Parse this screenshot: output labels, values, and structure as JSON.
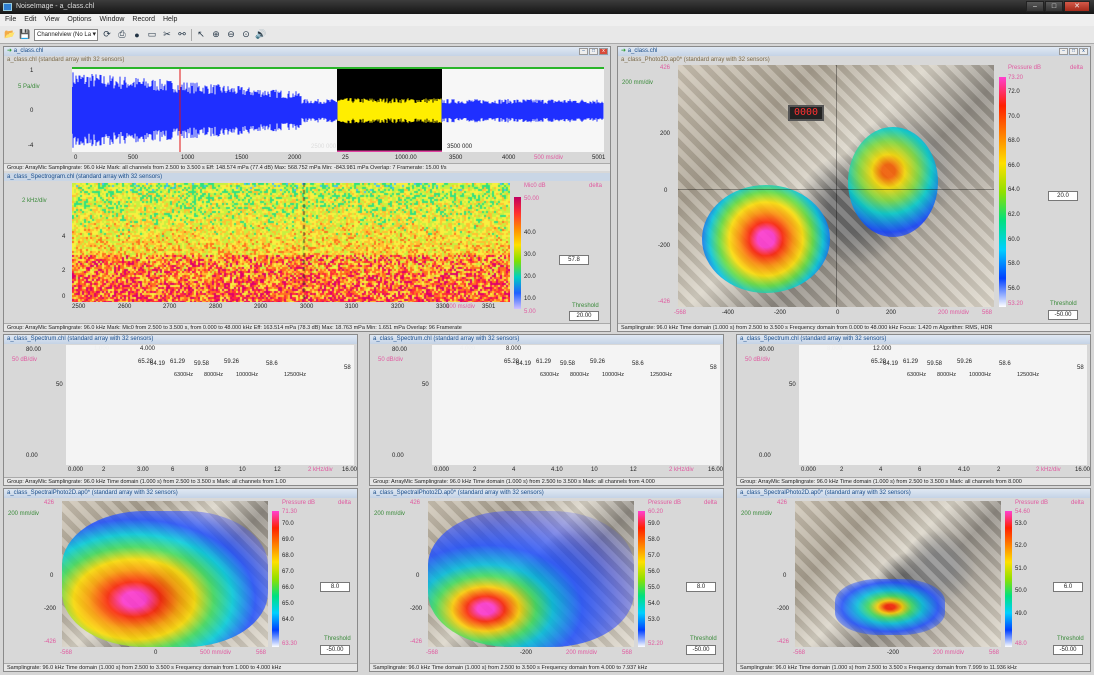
{
  "app": {
    "title": "NoiseImage - a_class.chl",
    "window_buttons": [
      "–",
      "□",
      "✕"
    ]
  },
  "menu": [
    "File",
    "Edit",
    "View",
    "Options",
    "Window",
    "Record",
    "Help"
  ],
  "toolbar": {
    "view_select": "Channelview (No La"
  },
  "top_left": {
    "window_title": "a_class.chl",
    "waveform": {
      "title": "a_class.chl (standard array with 32 sensors)",
      "y_top": "1",
      "y_unit": "5 Pa/div",
      "y_mid": "0",
      "y_bottom": "-4",
      "x_ticks": [
        "0",
        "500",
        "1000",
        "1500",
        "2000",
        "25",
        "1000.00",
        "3500",
        "4000"
      ],
      "x_scale": "500 ms/div",
      "x_end": "5001",
      "marker_left": "2500 000",
      "marker_right": "3500 000",
      "status": "Group: ArrayMic Samplingrate: 96.0 kHz  Mark: all channels from 2.500 to 3.500 s  Eff: 148.574 mPa (77.4 dB)  Max: 568.752 mPa  Min: -843.981 mPa  Overlap: 7   Framerate: 15.00 f/s"
    },
    "spectrogram": {
      "title": "a_class_Spectrogram.chl (standard array with 32 sensors)",
      "y_unit": "2 kHz/div",
      "y_ticks": [
        "4",
        "2",
        "0"
      ],
      "x_ticks": [
        "2500",
        "2600",
        "2700",
        "2800",
        "2900",
        "3000",
        "3100",
        "3200",
        "3300"
      ],
      "x_scale": "100 ms/div",
      "x_end": "3501",
      "cbar_title": "Mic0 dB",
      "cbar_delta": "delta",
      "cbar_ticks": [
        "50.00",
        "40.0",
        "30.0",
        "20.0",
        "10.0"
      ],
      "cbar_bottom": "5.00",
      "value_box": "57.8",
      "threshold_label": "Threshold",
      "threshold_value": "20.00",
      "status": "Group: ArrayMic Samplingrate: 96.0 kHz  Mark: Mic0 from 2.500 to 3.500 s, from 0.000 to 48.000 kHz   Eff: 163.514 mPa (78.3 dB)  Max: 18.763 mPa  Min: 1.651 mPa   Overlap: 96  Framerate"
    }
  },
  "top_right": {
    "window_title": "a_class.chl",
    "title": "a_class_Photo2D.ap0* (standard array with 32 sensors)",
    "y_top": "426",
    "y_unit": "200 mm/div",
    "y_ticks": [
      "200",
      "0",
      "-200"
    ],
    "y_bottom": "-426",
    "x_ticks": [
      "-568",
      "-400",
      "-200",
      "0",
      "200"
    ],
    "x_scale": "200 mm/div",
    "x_end": "568",
    "display_reading": "0000",
    "cbar_title": "Pressure dB",
    "cbar_delta": "delta",
    "cbar_top": "73.20",
    "cbar_ticks": [
      "72.0",
      "70.0",
      "68.0",
      "66.0",
      "64.0",
      "62.0",
      "60.0",
      "58.0",
      "56.0"
    ],
    "cbar_bottom": "53.20",
    "value_box": "20.0",
    "threshold_label": "Threshold",
    "threshold_value": "-50.00",
    "status": "Samplingrate: 96.0 kHz  Time domain (1.000 s) from 2.500 to 3.500 s  Frequency domain from 0.000 to 48.000 kHz  Focus: 1.420 m  Algorithm: RMS, HDR"
  },
  "spectra": [
    {
      "title": "a_class_Spectrum.chl (standard array with 32 sensors)",
      "y_top": "80.00",
      "y_unit": "50 dB/div",
      "y_mid": "50",
      "y_bottom": "0.00",
      "band_label_left": "1.000",
      "band_label_right": "4.000",
      "peaks": [
        "65.20",
        "64.19",
        "61.29",
        "59.58",
        "59.26",
        "58.6"
      ],
      "bands": [
        "6300Hz",
        "8000Hz",
        "10000Hz",
        "12500Hz"
      ],
      "x_ticks": [
        "0.000",
        "2",
        "3.00",
        "6",
        "8",
        "10",
        "12",
        "2 kHz/div",
        "16.000"
      ],
      "right_edge": "58",
      "status": "Group: ArrayMic Samplingrate: 96.0 kHz  Time domain (1.000 s) from 2.500 to 3.500 s  Mark: all channels from 1.00"
    },
    {
      "title": "a_class_Spectrum.chl (standard array with 32 sensors)",
      "y_top": "80.00",
      "y_unit": "50 dB/div",
      "y_mid": "50",
      "y_bottom": "0.00",
      "band_label_left": "4.000",
      "band_label_right": "8.000",
      "peaks": [
        "65.20",
        "64.19",
        "61.29",
        "59.58",
        "59.26",
        "58.6"
      ],
      "bands": [
        "6300Hz",
        "8000Hz",
        "10000Hz",
        "12500Hz"
      ],
      "x_ticks": [
        "0.000",
        "2",
        "4",
        "4.10",
        "10",
        "12",
        "2 kHz/div",
        "16.000"
      ],
      "right_edge": "58",
      "status": "Group: ArrayMic Samplingrate: 96.0 kHz  Time domain (1.000 s) from 2.500 to 3.500 s  Mark: all channels from 4.000"
    },
    {
      "title": "a_class_Spectrum.chl (standard array with 32 sensors)",
      "y_top": "80.00",
      "y_unit": "50 dB/div",
      "y_mid": "50",
      "y_bottom": "0.00",
      "band_label_left": "8.000",
      "band_label_right": "12.000",
      "peaks": [
        "65.20",
        "64.19",
        "61.29",
        "59.58",
        "59.26",
        "58.6"
      ],
      "bands": [
        "6300Hz",
        "8000Hz",
        "10000Hz",
        "12500Hz"
      ],
      "x_ticks": [
        "0.000",
        "2",
        "4",
        "6",
        "4.10",
        "2",
        "2 kHz/div",
        "16.000"
      ],
      "right_edge": "58",
      "status": "Group: ArrayMic Samplingrate: 96.0 kHz  Time domain (1.000 s) from 2.500 to 3.500 s  Mark: all channels from 8.000"
    }
  ],
  "maps": [
    {
      "title": "a_class_SpectralPhoto2D.ap0* (standard array with 32 sensors)",
      "y_top": "426",
      "y_unit": "200 mm/div",
      "y_ticks": [
        "0",
        "-200"
      ],
      "y_bottom": "-426",
      "x_left": "-568",
      "x_mid": "0",
      "x_scale": "500 mm/div",
      "x_end": "568",
      "cbar_title": "Pressure dB",
      "cbar_delta": "delta",
      "cbar_top": "71.30",
      "cbar_ticks": [
        "70.0",
        "69.0",
        "68.0",
        "67.0",
        "66.0",
        "65.0",
        "64.0"
      ],
      "cbar_bottom": "63.30",
      "value_box": "8.0",
      "threshold_label": "Threshold",
      "threshold_value": "-50.00",
      "status": "Samplingrate: 96.0 kHz  Time domain (1.000 s) from 2.500 to 3.500 s  Frequency domain from 1.000 to 4.000 kHz"
    },
    {
      "title": "a_class_SpectralPhoto2D.ap0* (standard array with 32 sensors)",
      "y_top": "426",
      "y_unit": "200 mm/div",
      "y_ticks": [
        "0",
        "-200"
      ],
      "y_bottom": "-426",
      "x_left": "-568",
      "x_mid": "-200",
      "x_scale": "200 mm/div",
      "x_end": "568",
      "cbar_title": "Pressure dB",
      "cbar_delta": "delta",
      "cbar_top": "60.20",
      "cbar_ticks": [
        "59.0",
        "58.0",
        "57.0",
        "56.0",
        "55.0",
        "54.0",
        "53.0"
      ],
      "cbar_bottom": "52.20",
      "value_box": "8.0",
      "threshold_label": "Threshold",
      "threshold_value": "-50.00",
      "status": "Samplingrate: 96.0 kHz  Time domain (1.000 s) from 2.500 to 3.500 s  Frequency domain from 4.000 to 7.937 kHz"
    },
    {
      "title": "a_class_SpectralPhoto2D.ap0* (standard array with 32 sensors)",
      "y_top": "426",
      "y_unit": "200 mm/div",
      "y_ticks": [
        "0",
        "-200"
      ],
      "y_bottom": "-426",
      "x_left": "-568",
      "x_mid": "-200",
      "x_scale": "200 mm/div",
      "x_end": "568",
      "cbar_title": "Pressure dB",
      "cbar_delta": "delta",
      "cbar_top": "54.60",
      "cbar_ticks": [
        "53.0",
        "52.0",
        "51.0",
        "50.0",
        "49.0"
      ],
      "cbar_bottom": "48.0",
      "value_box": "6.0",
      "threshold_label": "Threshold",
      "threshold_value": "-50.00",
      "status": "Samplingrate: 96.0 kHz  Time domain (1.000 s) from 2.500 to 3.500 s  Frequency domain from 7.999 to 11.936 kHz"
    }
  ],
  "colors": {
    "waveform": "#1f2fff",
    "waveform_highlight": "#ffee00",
    "spectrum_fill": "#3ccfc7",
    "spectrum_band": "#e23a2a",
    "accent_pink": "#e05aa0",
    "marker_red": "#e01010"
  }
}
